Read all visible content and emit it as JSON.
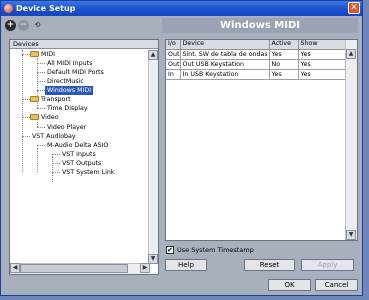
{
  "window": {
    "title": "Device Setup",
    "close_label": "✕"
  },
  "toolbar": {
    "add_icon": "+",
    "remove_icon": "−",
    "reset_icon": "⟲"
  },
  "header": {
    "title": "Windows MIDI"
  },
  "devices": {
    "header": "Devices",
    "tree": [
      {
        "label": "MIDI",
        "folder": true
      },
      {
        "label": "All MIDI Inputs"
      },
      {
        "label": "Default MIDI Ports"
      },
      {
        "label": "DirectMusic"
      },
      {
        "label": "Windows MIDI",
        "selected": true
      },
      {
        "label": "Transport",
        "folder": true
      },
      {
        "label": "Time Display"
      },
      {
        "label": "Video",
        "folder": true
      },
      {
        "label": "Video Player"
      },
      {
        "label": "VST Audiobay"
      },
      {
        "label": "M-Audio Delta ASIO"
      },
      {
        "label": "VST Inputs"
      },
      {
        "label": "VST Outputs"
      },
      {
        "label": "VST System Link"
      }
    ]
  },
  "midi_table": {
    "columns": [
      "I/o",
      "Device",
      "Active",
      "Show"
    ],
    "rows": [
      {
        "io": "Out",
        "device": "Sint. SW de tabla de ondas GS (",
        "active": "Yes",
        "show": "Yes"
      },
      {
        "io": "Out",
        "device": "Out USB Keystation",
        "active": "No",
        "show": "Yes"
      },
      {
        "io": "In",
        "device": "In USB Keystation",
        "active": "Yes",
        "show": "Yes"
      }
    ]
  },
  "timestamp": {
    "label": "Use System Timestamp",
    "checked": true,
    "check_mark": "✔"
  },
  "buttons": {
    "help": "Help",
    "reset": "Reset",
    "apply": "Apply",
    "ok": "OK",
    "cancel": "Cancel"
  },
  "colors": {
    "titlebar": "#1e55d0",
    "selection": "#2a58b9",
    "dialog_bg": "#a9b0bd"
  }
}
